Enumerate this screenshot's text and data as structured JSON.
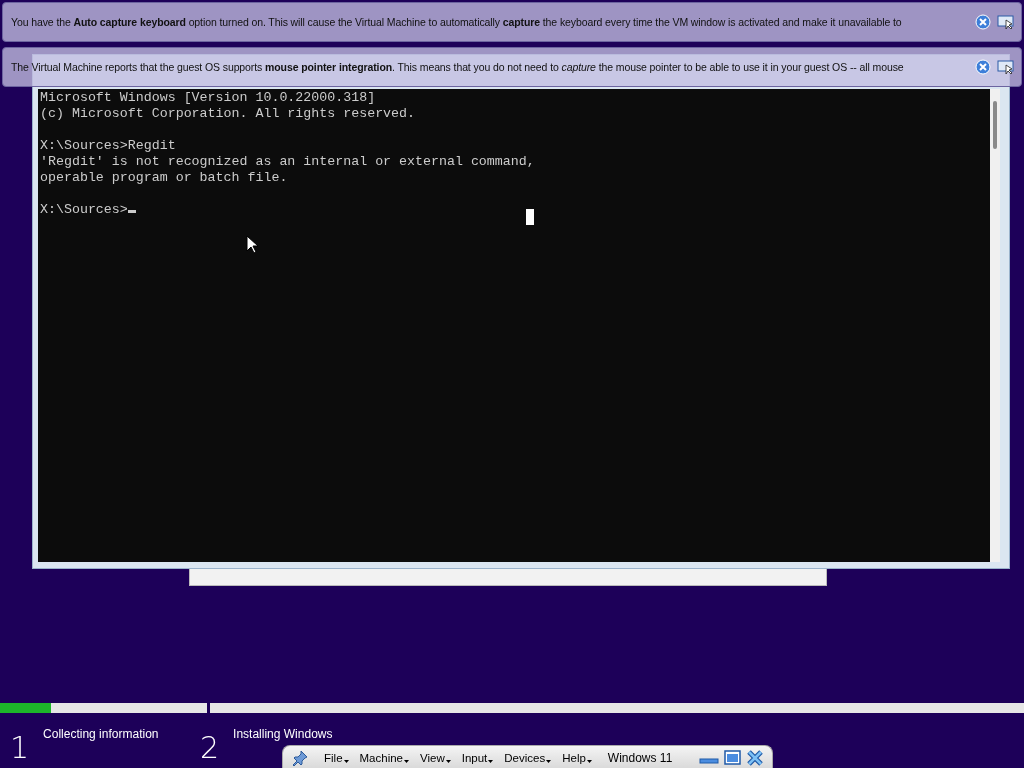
{
  "notifications": [
    {
      "text": "You have the **Auto capture keyboard** option turned on. This will cause the Virtual Machine to automatically **capture** the keyboard every time the VM window is activated and make it unavailable to"
    },
    {
      "text": "The Virtual Machine reports that the guest OS supports **mouse pointer integration**. This means that you do not need to *capture* the mouse pointer to be able to use it in your guest OS -- all mouse"
    }
  ],
  "console": {
    "blocks": [
      {
        "lines": [
          "Microsoft Windows [Version 10.0.22000.318]",
          "(c) Microsoft Corporation. All rights reserved."
        ]
      },
      {
        "lines": [
          "X:\\Sources>Regdit",
          "'Regdit' is not recognized as an internal or external command,",
          "operable program or batch file."
        ]
      },
      {
        "lines": [
          "X:\\Sources>"
        ]
      }
    ]
  },
  "setup": {
    "progress": {
      "level": 0.05
    },
    "steps": [
      {
        "number": "1",
        "label": "Collecting information"
      },
      {
        "number": "2",
        "label": "Installing Windows"
      }
    ]
  },
  "mini_toolbar": {
    "menus": [
      "File",
      "Machine",
      "View",
      "Input",
      "Devices",
      "Help"
    ],
    "vm_name": "Windows 11"
  }
}
